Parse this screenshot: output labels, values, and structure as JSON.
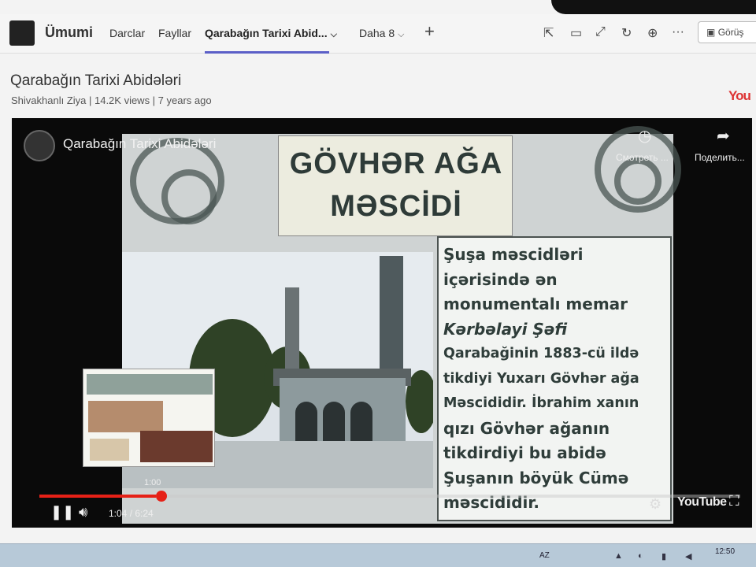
{
  "header": {
    "team_name": "Ümumi",
    "tabs": [
      {
        "label": "Darclar"
      },
      {
        "label": "Fayllar"
      },
      {
        "label": "Qarabağın Tarixi Abid..."
      },
      {
        "label": "Daha 8"
      }
    ],
    "add_icon": "plus-icon",
    "meet_label": "Görüş"
  },
  "video": {
    "title": "Qarabağın Tarixi Abidələri",
    "meta": "Shivakhanlı Ziya | 14.2K views | 7 years ago",
    "badge": "You"
  },
  "player": {
    "channel_title": "Qarabağın Tarixi Abidələri",
    "watch_later": "Смотреть ...",
    "share": "Поделить...",
    "hover_time": "1:00",
    "time": "1:04 / 6:24",
    "progress": 0.166,
    "logo": "YouTube",
    "accent": "#e62117"
  },
  "slide": {
    "title_line1": "GÖVHƏR AĞA",
    "title_line2": "MƏSCİDİ",
    "text_lines": [
      "Şuşa məscidləri",
      "içərisində ən",
      "monumentalı memar",
      "Kərbəlayi Şəfi",
      "Qarabağinin 1883-cü ildə",
      "tikdiyi Yuxarı Gövhər ağa",
      "Məscididir. İbrahim xanın",
      "qızı Gövhər ağanın",
      "tikdirdiyi bu abidə",
      "Şuşanın böyük Cümə",
      "məscididir."
    ]
  },
  "taskbar": {
    "lang": "AZ",
    "clock": "12:50"
  }
}
